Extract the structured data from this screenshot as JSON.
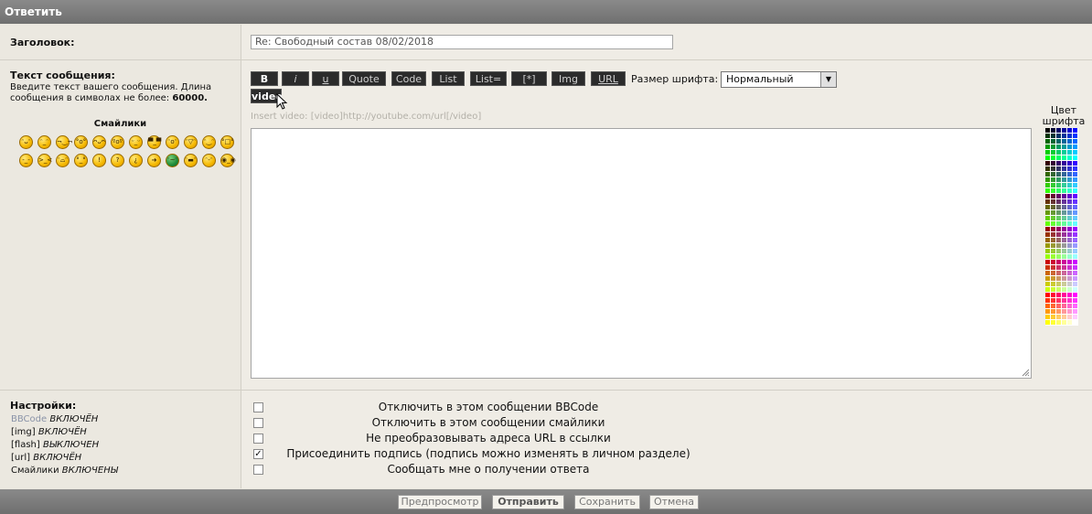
{
  "window": {
    "title": "Ответить"
  },
  "subject": {
    "label": "Заголовок:",
    "value": "Re: Свободный состав 08/02/2018"
  },
  "message": {
    "label": "Текст сообщения:",
    "hint_text": "Введите текст вашего сообщения. Длина сообщения в символах не более:",
    "max_chars": "60000.",
    "smilies_label": "Смайлики"
  },
  "toolbar": {
    "buttons": [
      "B",
      "i",
      "u",
      "Quote",
      "Code",
      "List",
      "List=",
      "[*]",
      "Img",
      "URL"
    ],
    "font_size_label": "Размер шрифта:",
    "font_size_value": "Нормальный",
    "video_button": "video",
    "help_text": "Insert video: [video]http://youtube.com/url[/video]",
    "font_color_label": "Цвет шрифта"
  },
  "settings": {
    "label": "Настройки:",
    "items": [
      {
        "name": "BBCode",
        "state": "ВКЛЮЧЁН"
      },
      {
        "name": "[img]",
        "state": "ВКЛЮЧЁН"
      },
      {
        "name": "[flash]",
        "state": "ВЫКЛЮЧЕН"
      },
      {
        "name": "[url]",
        "state": "ВКЛЮЧЁН"
      },
      {
        "name": "Смайлики",
        "state": "ВКЛЮЧЕНЫ"
      }
    ],
    "options": [
      {
        "label": "Отключить в этом сообщении BBCode",
        "checked": false
      },
      {
        "label": "Отключить в этом сообщении смайлики",
        "checked": false
      },
      {
        "label": "Не преобразовывать адреса URL в ссылки",
        "checked": false
      },
      {
        "label": "Присоединить подпись (подпись можно изменять в личном разделе)",
        "checked": true
      },
      {
        "label": "Сообщать мне о получении ответа",
        "checked": false
      }
    ]
  },
  "footer": {
    "preview": "Предпросмотр",
    "submit": "Отправить",
    "save": "Сохранить",
    "cancel": "Отмена"
  },
  "colors": {
    "titlebar": "#777777",
    "toolbar_button": "#2b2b2b",
    "background": "#e9e6de"
  }
}
